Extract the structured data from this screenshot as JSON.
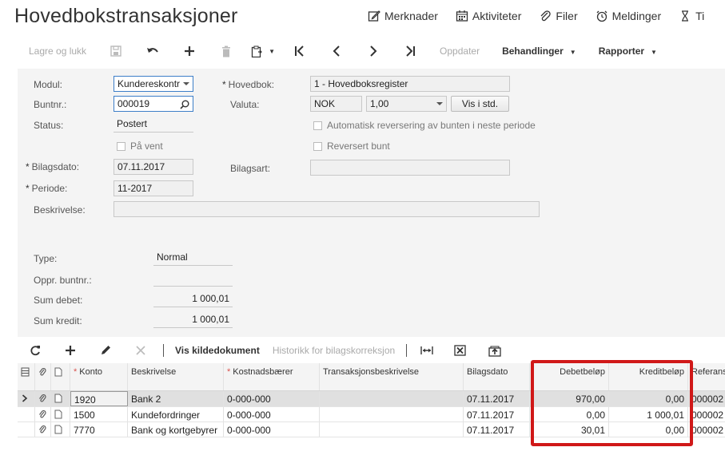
{
  "header": {
    "title": "Hovedbokstransaksjoner",
    "links": [
      {
        "label": "Merknader",
        "icon": "edit-note-icon"
      },
      {
        "label": "Aktiviteter",
        "icon": "calendar-icon"
      },
      {
        "label": "Filer",
        "icon": "paperclip-icon"
      },
      {
        "label": "Meldinger",
        "icon": "alarm-clock-icon"
      },
      {
        "label": "Ti",
        "icon": "hourglass-icon"
      }
    ]
  },
  "toolbar": {
    "save_close": "Lagre og lukk",
    "update": "Oppdater",
    "actions": "Behandlinger",
    "reports": "Rapporter"
  },
  "form": {
    "module_label": "Modul:",
    "module_value": "Kundereskontr",
    "batch_label": "Buntnr.:",
    "batch_value": "000019",
    "status_label": "Status:",
    "status_value": "Postert",
    "hold_label": "På vent",
    "docdate_label": "Bilagsdato:",
    "docdate_value": "07.11.2017",
    "period_label": "Periode:",
    "period_value": "11-2017",
    "desc_label": "Beskrivelse:",
    "desc_value": "",
    "ledger_label": "Hovedbok:",
    "ledger_value": "1 - Hovedboksregister",
    "currency_label": "Valuta:",
    "currency_value": "NOK",
    "rate_value": "1,00",
    "view_base_button": "Vis i std.",
    "auto_reverse_label": "Automatisk reversering av bunten i neste periode",
    "reversed_label": "Reversert bunt",
    "doctype_label": "Bilagsart:",
    "doctype_value": "",
    "type_label": "Type:",
    "type_value": "Normal",
    "orig_batch_label": "Oppr. buntnr.:",
    "orig_batch_value": "",
    "sum_debit_label": "Sum debet:",
    "sum_debit_value": "1 000,01",
    "sum_credit_label": "Sum kredit:",
    "sum_credit_value": "1 000,01"
  },
  "grid_toolbar": {
    "view_source": "Vis kildedokument",
    "history": "Historikk for bilagskorreksjon"
  },
  "grid": {
    "headers": {
      "account": "Konto",
      "description": "Beskrivelse",
      "subaccount": "Kostnadsbærer",
      "trans_desc": "Transaksjonsbeskrivelse",
      "date": "Bilagsdato",
      "debit": "Debetbeløp",
      "credit": "Kreditbeløp",
      "ref": "Referans"
    },
    "rows": [
      {
        "account": "1920",
        "description": "Bank 2",
        "subaccount": "0-000-000",
        "trans_desc": "",
        "date": "07.11.2017",
        "debit": "970,00",
        "credit": "0,00",
        "ref": "000002"
      },
      {
        "account": "1500",
        "description": "Kundefordringer",
        "subaccount": "0-000-000",
        "trans_desc": "",
        "date": "07.11.2017",
        "debit": "0,00",
        "credit": "1 000,01",
        "ref": "000002"
      },
      {
        "account": "7770",
        "description": "Bank og kortgebyrer",
        "subaccount": "0-000-000",
        "trans_desc": "",
        "date": "07.11.2017",
        "debit": "30,01",
        "credit": "0,00",
        "ref": "000002"
      }
    ]
  },
  "colors": {
    "highlight": "#d01818",
    "selected_row": "#e0e0e0",
    "panel": "#f4f4f4"
  }
}
